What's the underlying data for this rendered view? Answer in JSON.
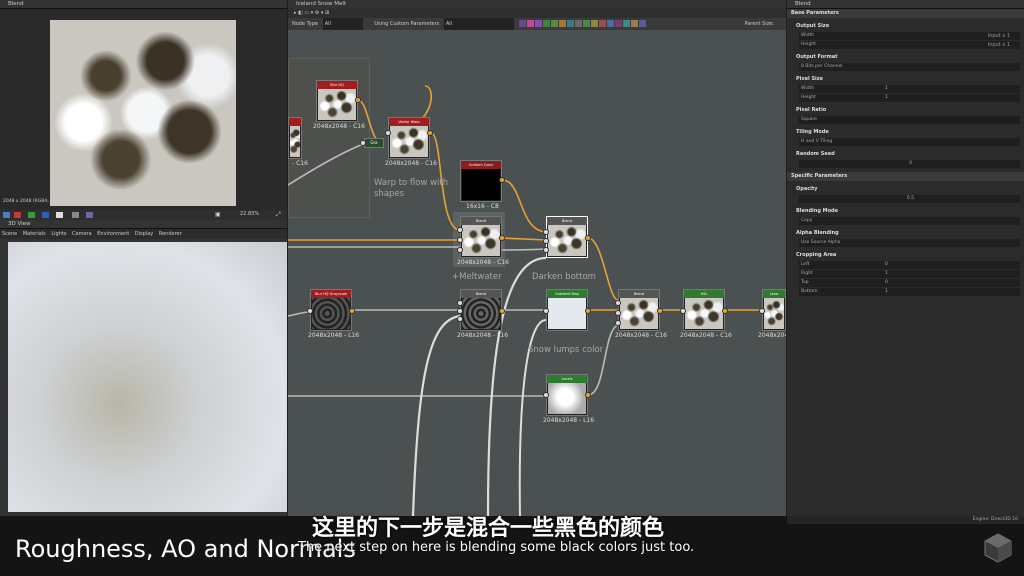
{
  "panels": {
    "view2d_title": "Blend",
    "view2d_info": "2048 x 2048 (RGBA, 16bpc)",
    "view2d_zoom": "22.83%",
    "view3d_title": "3D View",
    "view3d_menu": [
      "Scene",
      "Materials",
      "Lights",
      "Camera",
      "Environment",
      "Display",
      "Renderer"
    ],
    "graph_title": "Iceland Snow Melt",
    "props_title": "Blend"
  },
  "graph_toolbar": {
    "node_type_label": "Node Type",
    "node_type_value": "All",
    "params_label": "Using Custom Parameters",
    "params_value": "All",
    "parent_size": "Parent Size:",
    "chip_colors": [
      "#6a4a8a",
      "#c04a90",
      "#8a4ab8",
      "#3a8a3a",
      "#5a8a3a",
      "#a07a30",
      "#3a7a8a",
      "#6a6a6a",
      "#4a8a4a",
      "#8a8a3a",
      "#a04a4a",
      "#4a6aa0",
      "#7a3a7a",
      "#3a8a8a",
      "#a07a4a",
      "#5a5a9a"
    ]
  },
  "nodes": {
    "blur_hq": {
      "title": "Blur HQ",
      "size": "2048x2048 - C16"
    },
    "vector_warp": {
      "title": "Vector Warp",
      "size": "2048x2048 - C16"
    },
    "gray_node": {
      "title": "Gra",
      "size": ""
    },
    "uniform_color": {
      "title": "Uniform Color",
      "size": "16x16 - C8"
    },
    "blend1": {
      "title": "Blend",
      "size": "2048x2048 - C16"
    },
    "blend2": {
      "title": "Blend",
      "size": "2048x2048 - C16"
    },
    "blur_gray": {
      "title": "Blur HQ Grayscale",
      "size": "2048x2048 - L16"
    },
    "blend3": {
      "title": "Blend",
      "size": "2048x2048 - L16"
    },
    "gradient_map": {
      "title": "Gradient Map",
      "size": "2048x2048 - C16"
    },
    "blend4": {
      "title": "Blend",
      "size": "2048x2048 - C16"
    },
    "hsl": {
      "title": "HSL",
      "size": "2048x2048 - C16"
    },
    "levels2": {
      "title": "Leve",
      "size": "2048x2048"
    },
    "levels": {
      "title": "Levels",
      "size": "2048x2048 - L16"
    },
    "c16_left": "- C16",
    "c16_left2": "- C16"
  },
  "comments": {
    "warp": "Warp to flow with shapes",
    "meltwater": "+Meltwater",
    "darken": "Darken bottom",
    "snow_lumps": "Snow lumps color"
  },
  "props": {
    "base_header": "Base Parameters",
    "output_size": "Output Size",
    "width": "Width",
    "height": "Height",
    "input_x1": "Input x 1",
    "output_format": "Output Format",
    "output_format_val": "8 Bits per Channel",
    "pixel_size": "Pixel Size",
    "pixel_ratio": "Pixel Ratio",
    "pixel_ratio_val": "Square",
    "tiling_mode": "Tiling Mode",
    "tiling_mode_val": "H and V Tiling",
    "random_seed": "Random Seed",
    "random_seed_val": "0",
    "specific_header": "Specific Parameters",
    "opacity": "Opacity",
    "opacity_val": "0.5",
    "blending_mode": "Blending Mode",
    "blending_mode_val": "Copy",
    "alpha_blending": "Alpha Blending",
    "alpha_blending_val": "Use Source Alpha",
    "cropping_area": "Cropping Area",
    "left": "Left",
    "right": "Right",
    "top": "Top",
    "bottom": "Bottom",
    "left_val": "0",
    "right_val": "1",
    "top_val": "0",
    "bottom_val": "1",
    "one": "1"
  },
  "status": {
    "engine": "Engine: Direct3D 10"
  },
  "overlay": {
    "course_title": "Roughness, AO and Normals",
    "subtitle_cn": "这里的下一步是混合一些黑色的颜色",
    "subtitle_en": "The next step on here is blending some black colors just too."
  }
}
